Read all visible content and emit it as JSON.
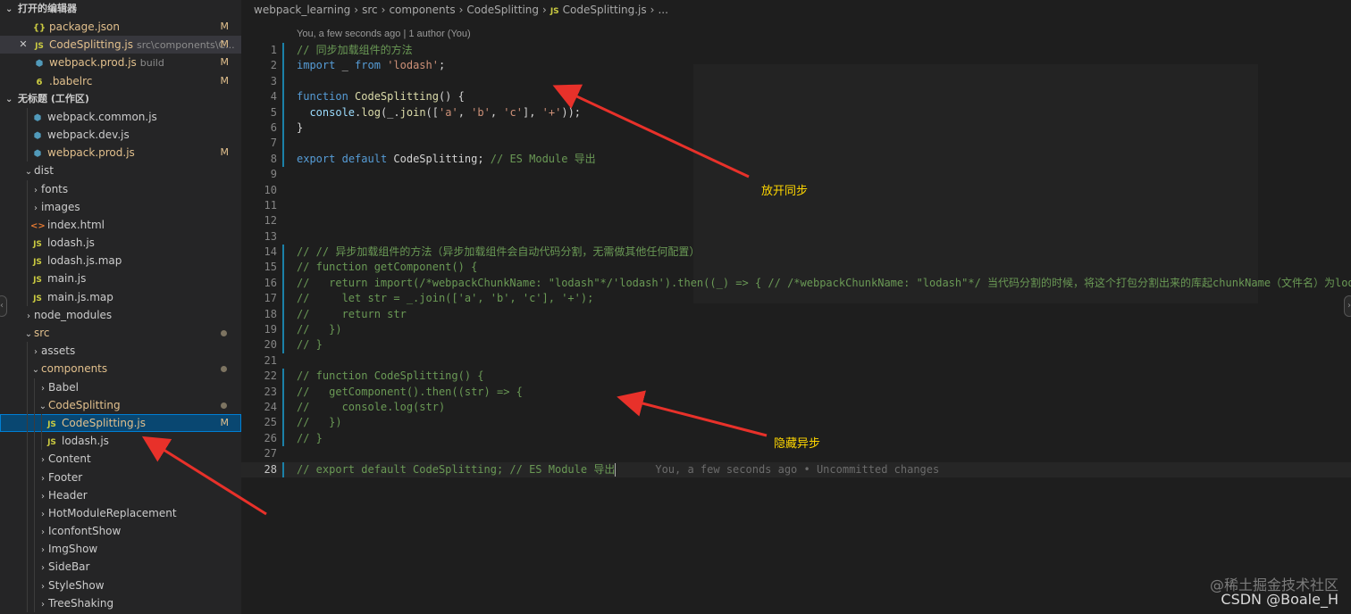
{
  "sidebar": {
    "open_editors_title": "打开的编辑器",
    "open_editors": [
      {
        "icon": "{}",
        "icon_kind": "json",
        "label": "package.json",
        "desc": "",
        "badge": "M",
        "active": false,
        "close": false
      },
      {
        "icon": "JS",
        "icon_kind": "js",
        "label": "CodeSplitting.js",
        "desc": "src\\components\\C...",
        "badge": "M",
        "active": true,
        "close": true
      },
      {
        "icon": "⬢",
        "icon_kind": "wp",
        "label": "webpack.prod.js",
        "desc": "build",
        "badge": "M",
        "active": false,
        "close": false
      },
      {
        "icon": "6",
        "icon_kind": "babel",
        "label": ".babelrc",
        "desc": "",
        "badge": "M",
        "active": false,
        "close": false
      }
    ],
    "workspace_title": "无标题 (工作区)",
    "tree": [
      {
        "label": "webpack.common.js",
        "icon": "⬢",
        "icon_kind": "wp",
        "depth": 1,
        "twist": "",
        "badge": "",
        "dot": false,
        "mod": false,
        "selected": false
      },
      {
        "label": "webpack.dev.js",
        "icon": "⬢",
        "icon_kind": "wp",
        "depth": 1,
        "twist": "",
        "badge": "",
        "dot": false,
        "mod": false,
        "selected": false
      },
      {
        "label": "webpack.prod.js",
        "icon": "⬢",
        "icon_kind": "wp",
        "depth": 1,
        "twist": "",
        "badge": "M",
        "dot": false,
        "mod": true,
        "selected": false
      },
      {
        "label": "dist",
        "icon": "",
        "icon_kind": "",
        "depth": 0,
        "twist": "⌄",
        "badge": "",
        "dot": false,
        "mod": false,
        "selected": false
      },
      {
        "label": "fonts",
        "icon": "",
        "icon_kind": "",
        "depth": 1,
        "twist": "›",
        "badge": "",
        "dot": false,
        "mod": false,
        "selected": false
      },
      {
        "label": "images",
        "icon": "",
        "icon_kind": "",
        "depth": 1,
        "twist": "›",
        "badge": "",
        "dot": false,
        "mod": false,
        "selected": false
      },
      {
        "label": "index.html",
        "icon": "<>",
        "icon_kind": "html",
        "depth": 1,
        "twist": "",
        "badge": "",
        "dot": false,
        "mod": false,
        "selected": false
      },
      {
        "label": "lodash.js",
        "icon": "JS",
        "icon_kind": "js",
        "depth": 1,
        "twist": "",
        "badge": "",
        "dot": false,
        "mod": false,
        "selected": false
      },
      {
        "label": "lodash.js.map",
        "icon": "JS",
        "icon_kind": "js",
        "depth": 1,
        "twist": "",
        "badge": "",
        "dot": false,
        "mod": false,
        "selected": false
      },
      {
        "label": "main.js",
        "icon": "JS",
        "icon_kind": "js",
        "depth": 1,
        "twist": "",
        "badge": "",
        "dot": false,
        "mod": false,
        "selected": false
      },
      {
        "label": "main.js.map",
        "icon": "JS",
        "icon_kind": "js",
        "depth": 1,
        "twist": "",
        "badge": "",
        "dot": false,
        "mod": false,
        "selected": false
      },
      {
        "label": "node_modules",
        "icon": "",
        "icon_kind": "",
        "depth": 0,
        "twist": "›",
        "badge": "",
        "dot": false,
        "mod": false,
        "selected": false
      },
      {
        "label": "src",
        "icon": "",
        "icon_kind": "",
        "depth": 0,
        "twist": "⌄",
        "badge": "",
        "dot": true,
        "mod": true,
        "selected": false
      },
      {
        "label": "assets",
        "icon": "",
        "icon_kind": "",
        "depth": 1,
        "twist": "›",
        "badge": "",
        "dot": false,
        "mod": false,
        "selected": false
      },
      {
        "label": "components",
        "icon": "",
        "icon_kind": "",
        "depth": 1,
        "twist": "⌄",
        "badge": "",
        "dot": true,
        "mod": true,
        "selected": false
      },
      {
        "label": "Babel",
        "icon": "",
        "icon_kind": "",
        "depth": 2,
        "twist": "›",
        "badge": "",
        "dot": false,
        "mod": false,
        "selected": false
      },
      {
        "label": "CodeSplitting",
        "icon": "",
        "icon_kind": "",
        "depth": 2,
        "twist": "⌄",
        "badge": "",
        "dot": true,
        "mod": true,
        "selected": false
      },
      {
        "label": "CodeSplitting.js",
        "icon": "JS",
        "icon_kind": "js",
        "depth": 3,
        "twist": "",
        "badge": "M",
        "dot": false,
        "mod": true,
        "selected": true
      },
      {
        "label": "lodash.js",
        "icon": "JS",
        "icon_kind": "js",
        "depth": 3,
        "twist": "",
        "badge": "",
        "dot": false,
        "mod": false,
        "selected": false
      },
      {
        "label": "Content",
        "icon": "",
        "icon_kind": "",
        "depth": 2,
        "twist": "›",
        "badge": "",
        "dot": false,
        "mod": false,
        "selected": false
      },
      {
        "label": "Footer",
        "icon": "",
        "icon_kind": "",
        "depth": 2,
        "twist": "›",
        "badge": "",
        "dot": false,
        "mod": false,
        "selected": false
      },
      {
        "label": "Header",
        "icon": "",
        "icon_kind": "",
        "depth": 2,
        "twist": "›",
        "badge": "",
        "dot": false,
        "mod": false,
        "selected": false
      },
      {
        "label": "HotModuleReplacement",
        "icon": "",
        "icon_kind": "",
        "depth": 2,
        "twist": "›",
        "badge": "",
        "dot": false,
        "mod": false,
        "selected": false
      },
      {
        "label": "IconfontShow",
        "icon": "",
        "icon_kind": "",
        "depth": 2,
        "twist": "›",
        "badge": "",
        "dot": false,
        "mod": false,
        "selected": false
      },
      {
        "label": "ImgShow",
        "icon": "",
        "icon_kind": "",
        "depth": 2,
        "twist": "›",
        "badge": "",
        "dot": false,
        "mod": false,
        "selected": false
      },
      {
        "label": "SideBar",
        "icon": "",
        "icon_kind": "",
        "depth": 2,
        "twist": "›",
        "badge": "",
        "dot": false,
        "mod": false,
        "selected": false
      },
      {
        "label": "StyleShow",
        "icon": "",
        "icon_kind": "",
        "depth": 2,
        "twist": "›",
        "badge": "",
        "dot": false,
        "mod": false,
        "selected": false
      },
      {
        "label": "TreeShaking",
        "icon": "",
        "icon_kind": "",
        "depth": 2,
        "twist": "›",
        "badge": "",
        "dot": false,
        "mod": false,
        "selected": false
      }
    ]
  },
  "editor": {
    "breadcrumb": [
      "webpack_learning",
      "src",
      "components",
      "CodeSplitting"
    ],
    "breadcrumb_file": "CodeSplitting.js",
    "breadcrumb_tail": "...",
    "codelens": "You, a few seconds ago | 1 author (You)",
    "blame": "You, a few seconds ago • Uncommitted changes",
    "lines": [
      {
        "n": "1",
        "bar": true,
        "html": [
          [
            "cm",
            "// 同步加载组件的方法"
          ]
        ]
      },
      {
        "n": "2",
        "bar": true,
        "html": [
          [
            "kw",
            "import"
          ],
          [
            "",
            " _ "
          ],
          [
            "kw",
            "from"
          ],
          [
            "",
            " "
          ],
          [
            "str",
            "'lodash'"
          ],
          [
            "",
            ";"
          ]
        ]
      },
      {
        "n": "3",
        "bar": true,
        "html": []
      },
      {
        "n": "4",
        "bar": true,
        "html": [
          [
            "kw",
            "function"
          ],
          [
            "",
            " "
          ],
          [
            "fn",
            "CodeSplitting"
          ],
          [
            "",
            "() {"
          ]
        ]
      },
      {
        "n": "5",
        "bar": true,
        "html": [
          [
            "",
            "  "
          ],
          [
            "var",
            "console"
          ],
          [
            "",
            "."
          ],
          [
            "fn",
            "log"
          ],
          [
            "",
            "(_."
          ],
          [
            "fn",
            "join"
          ],
          [
            "",
            "(["
          ],
          [
            "str",
            "'a'"
          ],
          [
            "",
            ", "
          ],
          [
            "str",
            "'b'"
          ],
          [
            "",
            ", "
          ],
          [
            "str",
            "'c'"
          ],
          [
            "",
            "], "
          ],
          [
            "str",
            "'+'"
          ],
          [
            "",
            "));"
          ]
        ]
      },
      {
        "n": "6",
        "bar": true,
        "html": [
          [
            "",
            "}"
          ]
        ]
      },
      {
        "n": "7",
        "bar": true,
        "html": []
      },
      {
        "n": "8",
        "bar": true,
        "html": [
          [
            "kw",
            "export"
          ],
          [
            "",
            " "
          ],
          [
            "kw",
            "default"
          ],
          [
            "",
            " CodeSplitting; "
          ],
          [
            "cm",
            "// ES Module 导出"
          ]
        ]
      },
      {
        "n": "9",
        "bar": false,
        "html": []
      },
      {
        "n": "10",
        "bar": false,
        "html": []
      },
      {
        "n": "11",
        "bar": false,
        "html": []
      },
      {
        "n": "12",
        "bar": false,
        "html": []
      },
      {
        "n": "13",
        "bar": false,
        "html": []
      },
      {
        "n": "14",
        "bar": true,
        "html": [
          [
            "cm",
            "// // 异步加载组件的方法（异步加载组件会自动代码分割，无需做其他任何配置）"
          ]
        ]
      },
      {
        "n": "15",
        "bar": true,
        "html": [
          [
            "cm",
            "// function getComponent() {"
          ]
        ]
      },
      {
        "n": "16",
        "bar": true,
        "html": [
          [
            "cm",
            "//   return import(/*webpackChunkName: \"lodash\"*/'lodash').then((_) => { // /*webpackChunkName: \"lodash\"*/ 当代码分割的时候，将这个打包分割出来的库起chunkName（文件名）为lodash"
          ]
        ]
      },
      {
        "n": "17",
        "bar": true,
        "html": [
          [
            "cm",
            "//     let str = _.join(['a', 'b', 'c'], '+');"
          ]
        ]
      },
      {
        "n": "18",
        "bar": true,
        "html": [
          [
            "cm",
            "//     return str"
          ]
        ]
      },
      {
        "n": "19",
        "bar": true,
        "html": [
          [
            "cm",
            "//   })"
          ]
        ]
      },
      {
        "n": "20",
        "bar": true,
        "html": [
          [
            "cm",
            "// }"
          ]
        ]
      },
      {
        "n": "21",
        "bar": false,
        "html": []
      },
      {
        "n": "22",
        "bar": true,
        "html": [
          [
            "cm",
            "// function CodeSplitting() {"
          ]
        ]
      },
      {
        "n": "23",
        "bar": true,
        "html": [
          [
            "cm",
            "//   getComponent().then((str) => {"
          ]
        ]
      },
      {
        "n": "24",
        "bar": true,
        "html": [
          [
            "cm",
            "//     console.log(str)"
          ]
        ]
      },
      {
        "n": "25",
        "bar": true,
        "html": [
          [
            "cm",
            "//   })"
          ]
        ]
      },
      {
        "n": "26",
        "bar": true,
        "html": [
          [
            "cm",
            "// }"
          ]
        ]
      },
      {
        "n": "27",
        "bar": false,
        "html": []
      },
      {
        "n": "28",
        "bar": true,
        "current": true,
        "html": [
          [
            "cm",
            "// export default CodeSplitting; // ES Module 导出"
          ]
        ]
      }
    ]
  },
  "annotations": {
    "sync": "放开同步",
    "async": "隐藏异步"
  },
  "watermark": {
    "juejin": "@稀土掘金技术社区",
    "csdn": "CSDN @Boale_H"
  },
  "colors": {
    "annotation_text": "#ffd700",
    "arrow": "#e8312a",
    "gutter_change_bar": "#1b81a8"
  }
}
